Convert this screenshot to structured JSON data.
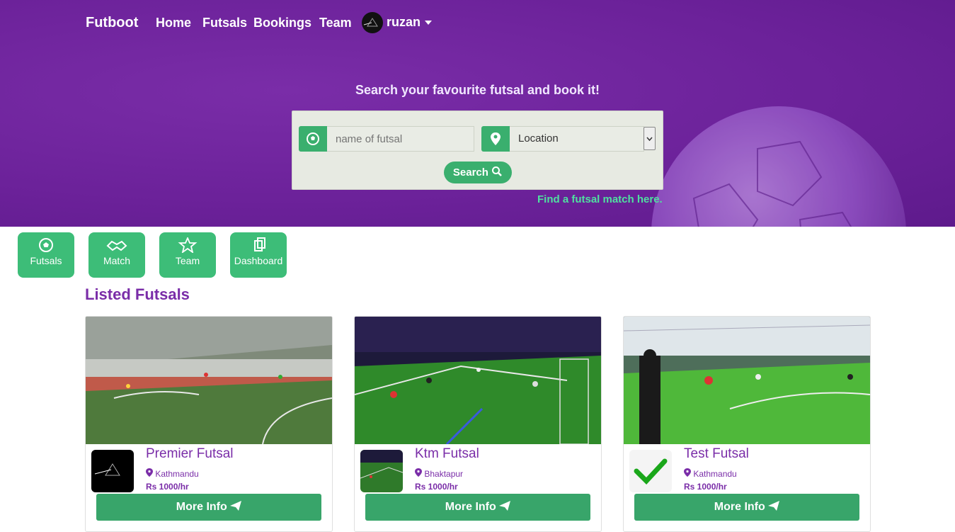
{
  "nav": {
    "brand": "Futboot",
    "links": [
      "Home",
      "Futsals",
      "Bookings",
      "Team"
    ],
    "user": "ruzan"
  },
  "hero": {
    "tagline": "Search your favourite futsal and book it!",
    "search": {
      "name_placeholder": "name of futsal",
      "location_selected": "Location",
      "button": "Search",
      "match_link": "Find a futsal match here."
    }
  },
  "quick_actions": [
    "Futsals",
    "Match",
    "Team",
    "Dashboard"
  ],
  "listed": {
    "title": "Listed Futsals",
    "futsals": [
      {
        "name": "Premier Futsal",
        "location": "Kathmandu",
        "price": "Rs 1000/hr",
        "button": "More Info"
      },
      {
        "name": "Ktm Futsal",
        "location": "Bhaktapur",
        "price": "Rs 1000/hr",
        "button": "More Info"
      },
      {
        "name": "Test Futsal",
        "location": "Kathmandu",
        "price": "Rs 1000/hr",
        "button": "More Info"
      }
    ]
  },
  "colors": {
    "purple": "#6b2199",
    "green": "#3aaf6e",
    "text_purple": "#7a2da8"
  }
}
